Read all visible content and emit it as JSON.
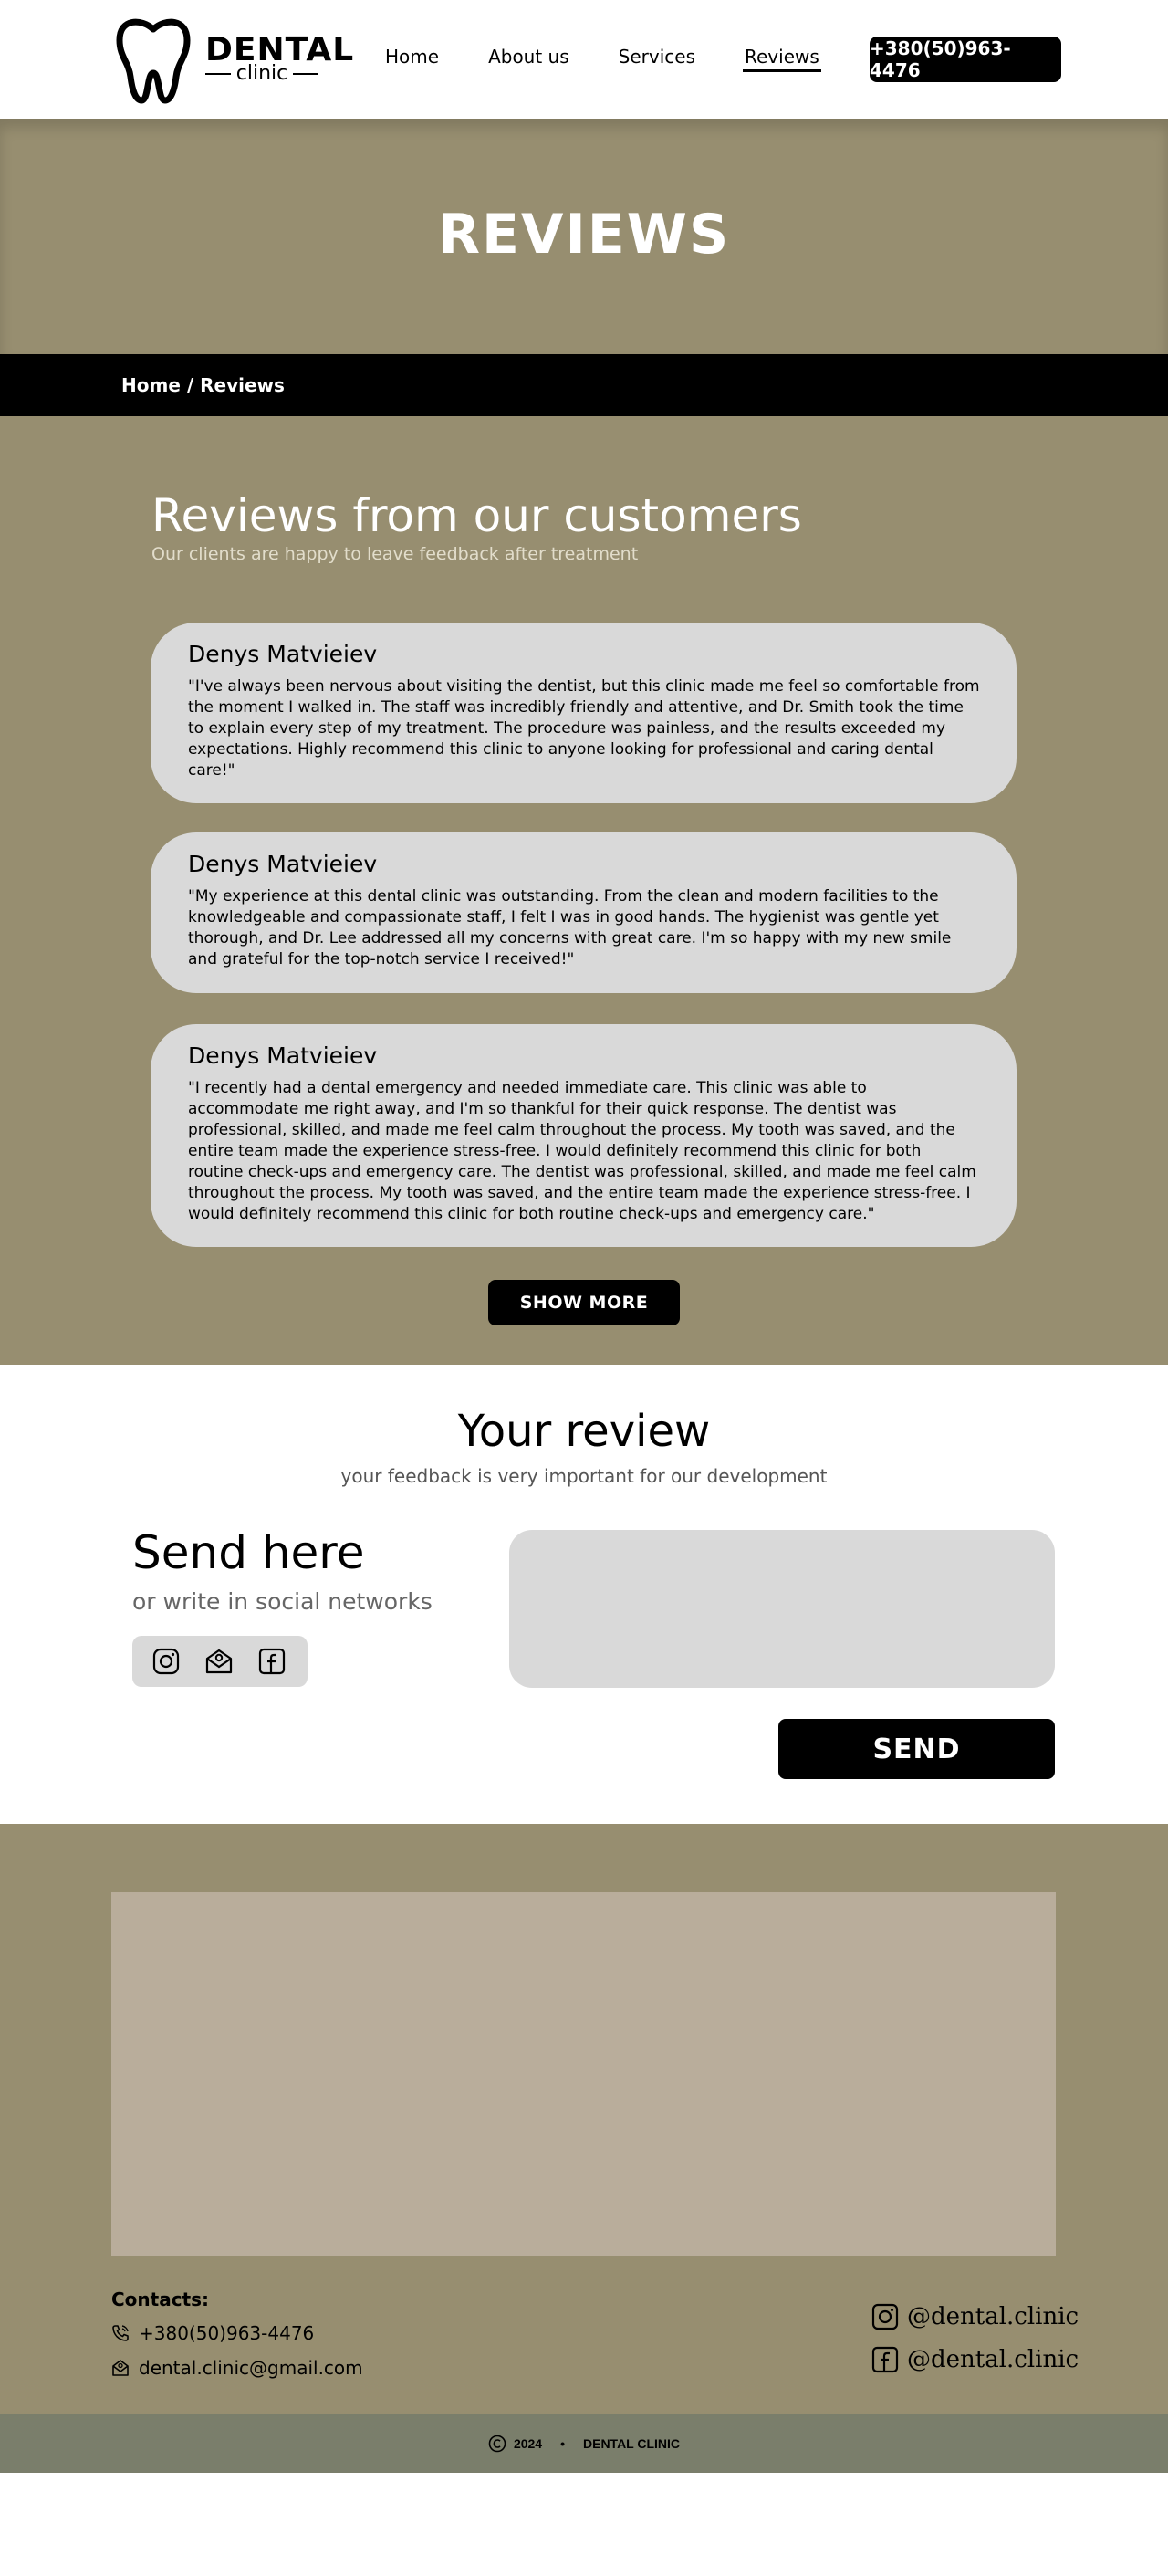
{
  "header": {
    "logo_title": "DENTAL",
    "logo_subtitle": "clinic",
    "nav": [
      {
        "label": "Home"
      },
      {
        "label": "About us"
      },
      {
        "label": "Services"
      },
      {
        "label": "Reviews"
      }
    ],
    "phone": "+380(50)963-4476"
  },
  "hero": {
    "title": "REVIEWS",
    "breadcrumb": "Home / Reviews"
  },
  "reviews": {
    "heading": "Reviews from our customers",
    "subheading": "Our clients are happy to leave feedback after treatment",
    "items": [
      {
        "name": "Denys Matvieiev",
        "text": "\"I've always been nervous about visiting the dentist, but this clinic made me feel so comfortable from the moment I walked in. The staff was incredibly friendly and attentive, and Dr. Smith took the time to explain every step of my treatment. The procedure was painless, and the results exceeded my expectations. Highly recommend this clinic to anyone looking for professional and caring dental care!\""
      },
      {
        "name": "Denys Matvieiev",
        "text": "\"My experience at this dental clinic was outstanding. From the clean and modern facilities to the knowledgeable and compassionate staff, I felt I was in good hands. The hygienist was gentle yet thorough, and Dr. Lee addressed all my concerns with great care. I'm so happy with my new smile and grateful for the top-notch service I received!\""
      },
      {
        "name": "Denys Matvieiev",
        "text": "\"I recently had a dental emergency and needed immediate care. This clinic was able to accommodate me right away, and I'm so thankful for their quick response. The dentist was professional, skilled, and made me feel calm throughout the process. My tooth was saved, and the entire team made the experience stress-free. I would definitely recommend this clinic for both routine check-ups and emergency care. The dentist was professional, skilled, and made me feel calm throughout the process. My tooth was saved, and the entire team made the experience stress-free. I would definitely recommend this clinic for both routine check-ups and emergency care.\""
      }
    ],
    "show_more": "SHOW MORE"
  },
  "your_review": {
    "title": "Your review",
    "subtitle": "your feedback is very important for our development",
    "send_here": "Send here",
    "send_sub": "or write in social networks",
    "social_icons": [
      "instagram-icon",
      "mail-icon",
      "facebook-icon"
    ],
    "input_value": "",
    "send_label": "SEND"
  },
  "footer": {
    "contacts_label": "Contacts:",
    "phone": "+380(50)963-4476",
    "email": "dental.clinic@gmail.com",
    "instagram": "@dental.clinic",
    "facebook": "@dental.clinic",
    "copyright_year": "2024",
    "copyright_name": "DENTAL CLINIC"
  },
  "colors": {
    "olive": "#978e70",
    "map_placeholder": "#b9ad9b",
    "card": "#d9d9d9",
    "copy_bar": "#7a7e6b"
  }
}
